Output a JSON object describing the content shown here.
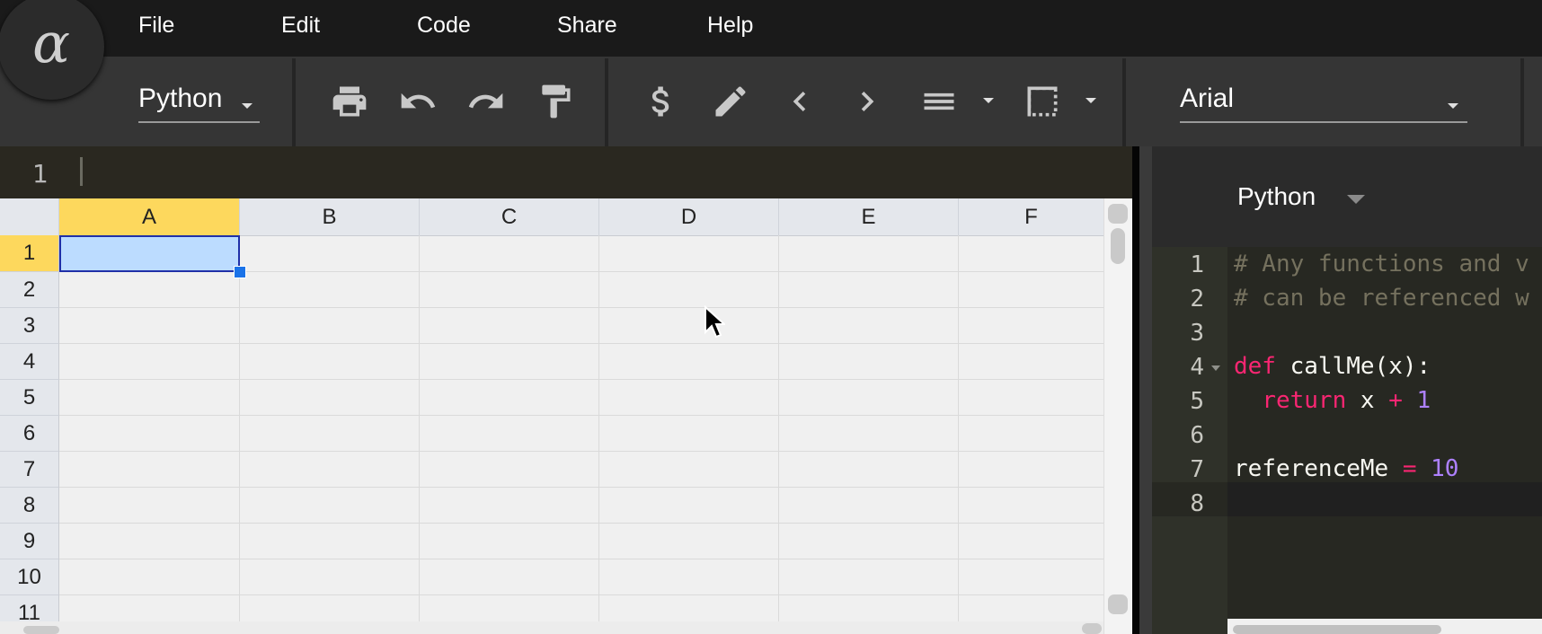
{
  "logo": {
    "glyph": "α"
  },
  "menubar": {
    "items": [
      {
        "label": "File"
      },
      {
        "label": "Edit"
      },
      {
        "label": "Code"
      },
      {
        "label": "Share"
      },
      {
        "label": "Help"
      }
    ]
  },
  "toolbar": {
    "language_select": {
      "value": "Python"
    },
    "font_select": {
      "value": "Arial"
    },
    "icons": [
      "print-icon",
      "undo-icon",
      "redo-icon",
      "paint-format-icon",
      "currency-icon",
      "edit-icon",
      "chevron-left-icon",
      "chevron-right-icon",
      "align-icon",
      "borders-icon"
    ]
  },
  "formula_bar": {
    "row_number": "1",
    "value": ""
  },
  "sheet": {
    "columns": [
      "A",
      "B",
      "C",
      "D",
      "E",
      "F"
    ],
    "rows": [
      "1",
      "2",
      "3",
      "4",
      "5",
      "6",
      "7",
      "8",
      "9",
      "10",
      "11"
    ],
    "active_cell": "A1"
  },
  "code_panel": {
    "language": "Python",
    "lines": [
      {
        "number": "1",
        "text": "# Any functions and v"
      },
      {
        "number": "2",
        "text": "# can be referenced w"
      },
      {
        "number": "3",
        "text": ""
      },
      {
        "number": "4",
        "text": "def callMe(x):"
      },
      {
        "number": "5",
        "text": "  return x + 1"
      },
      {
        "number": "6",
        "text": ""
      },
      {
        "number": "7",
        "text": "referenceMe = 10"
      },
      {
        "number": "8",
        "text": ""
      }
    ]
  },
  "colors": {
    "menubar_bg": "#1a1a1a",
    "toolbar_bg": "#353535",
    "active_header": "#fdd85d",
    "selection_fill": "#bcdcff",
    "selection_border": "#2030a8",
    "keyword": "#f92672",
    "number": "#ae81ff",
    "comment": "#75715e"
  }
}
